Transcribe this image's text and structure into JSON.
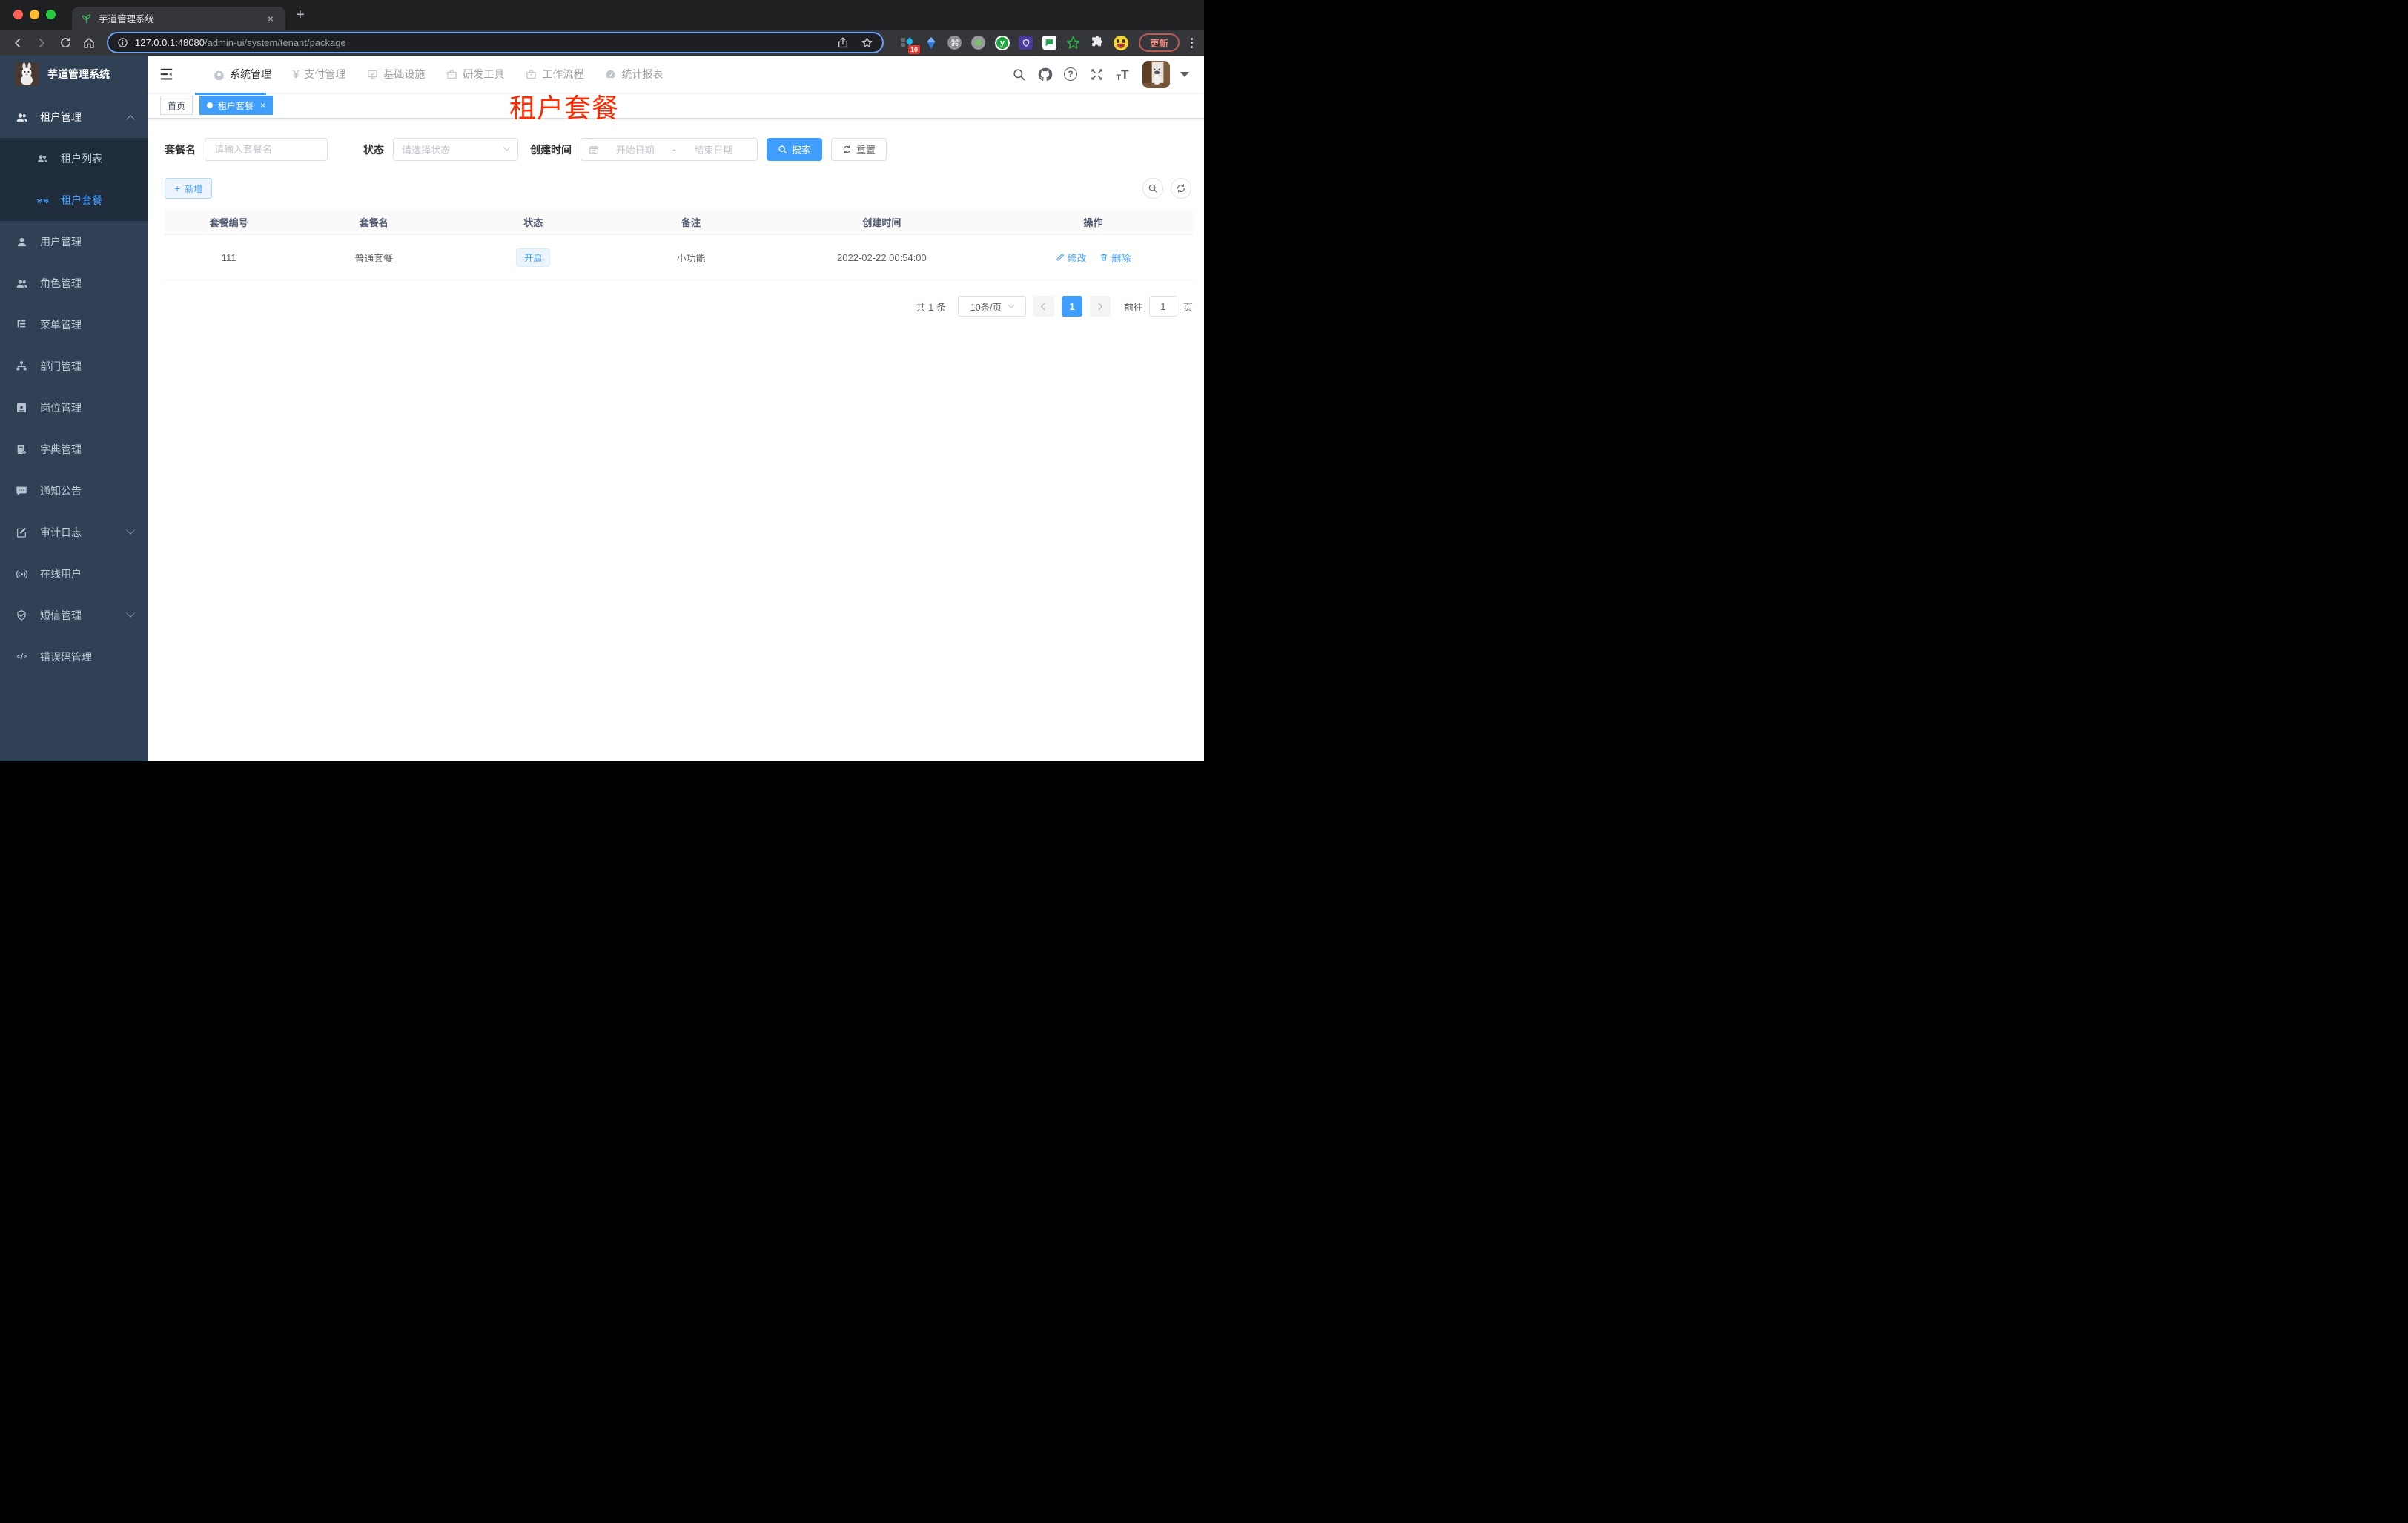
{
  "icons": {
    "close": "×",
    "plus": "+",
    "command": "⌘",
    "yen": "¥",
    "question": "?",
    "y_letter": "y",
    "code": "</>",
    "text_size_small": "T",
    "text_size_big": "T"
  },
  "colors": {
    "accent": "#409eff",
    "watermark_red": "#fe2b00",
    "sidebar_bg": "#304156",
    "submenu_bg": "#1f2d3d",
    "status_tag_bg": "#ecf5ff",
    "status_tag_text": "#409eff",
    "update_button_text": "#ee8a7f"
  },
  "browser": {
    "tab_title": "芋道管理系统",
    "url_host": "127.0.0.1:48080",
    "url_path": "/admin-ui/system/tenant/package",
    "extension_badge": "10",
    "update_label": "更新"
  },
  "app": {
    "logo_title": "芋道管理系统",
    "top_nav": [
      {
        "label": "系统管理"
      },
      {
        "label": "支付管理"
      },
      {
        "label": "基础设施"
      },
      {
        "label": "研发工具"
      },
      {
        "label": "工作流程"
      },
      {
        "label": "统计报表"
      }
    ],
    "sidebar": [
      {
        "label": "租户管理"
      },
      {
        "label": "租户列表"
      },
      {
        "label": "租户套餐"
      },
      {
        "label": "用户管理"
      },
      {
        "label": "角色管理"
      },
      {
        "label": "菜单管理"
      },
      {
        "label": "部门管理"
      },
      {
        "label": "岗位管理"
      },
      {
        "label": "字典管理"
      },
      {
        "label": "通知公告"
      },
      {
        "label": "审计日志"
      },
      {
        "label": "在线用户"
      },
      {
        "label": "短信管理"
      },
      {
        "label": "错误码管理"
      }
    ],
    "tags": {
      "home": "首页",
      "active": "租户套餐"
    },
    "watermark": "租户套餐",
    "filter": {
      "name_label": "套餐名",
      "name_placeholder": "请输入套餐名",
      "status_label": "状态",
      "status_placeholder": "请选择状态",
      "time_label": "创建时间",
      "time_start": "开始日期",
      "time_separator": "-",
      "time_end": "结束日期",
      "search_label": "搜索",
      "reset_label": "重置"
    },
    "toolbar": {
      "add_label": "新增"
    },
    "table": {
      "columns": [
        "套餐编号",
        "套餐名",
        "状态",
        "备注",
        "创建时间",
        "操作"
      ],
      "rows": [
        {
          "id": "111",
          "name": "普通套餐",
          "status": "开启",
          "remark": "小功能",
          "created": "2022-02-22 00:54:00",
          "edit_label": "修改",
          "delete_label": "删除"
        }
      ]
    },
    "pagination": {
      "total": "共 1 条",
      "page_size": "10条/页",
      "current_page": "1",
      "goto_label": "前往",
      "goto_value": "1",
      "page_unit": "页"
    }
  }
}
